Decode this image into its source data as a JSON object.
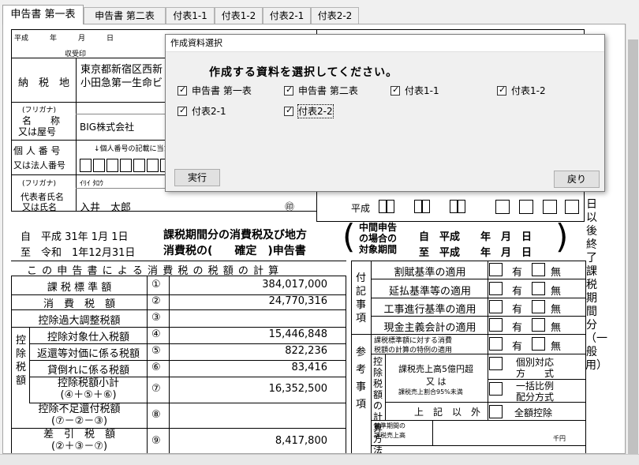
{
  "tabs": [
    {
      "label": "申告書 第一表",
      "active": true
    },
    {
      "label": "申告書 第二表"
    },
    {
      "label": "付表1-1"
    },
    {
      "label": "付表1-2"
    },
    {
      "label": "付表2-1"
    },
    {
      "label": "付表2-2"
    }
  ],
  "form": {
    "date_header": "平成　　　年　　　月　　　日",
    "received_stamp": "収受印",
    "address_label": "納　税　地",
    "address_line1": "東京都新宿区西新",
    "address_line2": "小田急第一生命ビ",
    "furigana": "(フリガナ)",
    "name_label_1": "名　　称",
    "name_label_2": "又は屋号",
    "company_name": "BIG株式会社",
    "number_label_1": "個 人 番 号",
    "number_label_2": "又は法人番号",
    "number_note": "↓個人番号の記載に当た",
    "rep_furigana": "ｲﾘｲ ﾀﾛｳ",
    "rep_label_1": "代表者氏名",
    "rep_label_2": "又は氏名",
    "rep_name": "入井　太郎",
    "seal": "㊞",
    "era_heisei": "平成",
    "period_from": "自　平成 31年 1月 1日",
    "period_to": "至　令和　1年12月31日",
    "title_line1": "課税期間分の消費税及び地方",
    "title_line2": "消費税の(　　確定　)申告書",
    "interim_label_1": "中間申告",
    "interim_label_2": "の場合の",
    "interim_label_3": "対象期間",
    "interim_from": "自　平成　　年　月　日",
    "interim_to": "至　平成　　年　月　日",
    "side_text": "日以後終了課税期間分（一般用）",
    "calc_header": "こ の 申 告 書 に よ る 消 費 税 の 税 額 の 計 算",
    "deduction_vertical": "控除税額",
    "rows": [
      {
        "label": "課 税 標 準 額",
        "num": "①",
        "value": "384,017,000"
      },
      {
        "label": "消　費　税　額",
        "num": "②",
        "value": "24,770,316"
      },
      {
        "label": "控除過大調整税額",
        "num": "③",
        "value": ""
      },
      {
        "label": "控除対象仕入税額",
        "num": "④",
        "value": "15,446,848"
      },
      {
        "label": "返還等対価に係る税額",
        "num": "⑤",
        "value": "822,236"
      },
      {
        "label": "貸倒れに係る税額",
        "num": "⑥",
        "value": "83,416"
      },
      {
        "label": "控除税額小計",
        "label2": "(④＋⑤＋⑥)",
        "num": "⑦",
        "value": "16,352,500"
      },
      {
        "label": "控除不足還付税額",
        "label2": "(⑦－②－③)",
        "num": "⑧",
        "value": ""
      },
      {
        "label": "差　引　税　額",
        "label2": "(②＋③－⑦)",
        "num": "⑨",
        "value": "8,417,800"
      }
    ],
    "notes_vertical": "付記事項",
    "ref_vertical": "参考事項",
    "notes": [
      {
        "label": "割賦基準の適用",
        "yes": "有",
        "no": "無"
      },
      {
        "label": "延払基準等の適用",
        "yes": "有",
        "no": "無"
      },
      {
        "label": "工事進行基準の適用",
        "yes": "有",
        "no": "無"
      },
      {
        "label": "現金主義会計の適用",
        "yes": "有",
        "no": "無"
      }
    ],
    "ref_special_1": "課税標準額に対する消費",
    "ref_special_2": "税額の計算の特例の適用",
    "ref_yes": "有",
    "ref_no": "無",
    "deduct_method_vertical": "控除税額の計算方法",
    "over500_1": "課税売上高5億円超",
    "over500_2": "又 は",
    "over500_3": "課税売上割合95%未満",
    "individual_1": "個別対応",
    "individual_2": "方　　式",
    "lump_1": "一括比例",
    "lump_2": "配分方式",
    "other_label": "上　記　以　外",
    "full_deduct": "全額控除",
    "base_sales_1": "基準期間の",
    "base_sales_2": "課税売上高",
    "thousand_yen": "千円",
    "heisei_short": "平成"
  },
  "dialog": {
    "title": "作成資料選択",
    "instruction": "作成する資料を選択してください。",
    "options": [
      {
        "label": "申告書 第一表",
        "checked": true
      },
      {
        "label": "申告書 第二表",
        "checked": true
      },
      {
        "label": "付表1-1",
        "checked": true
      },
      {
        "label": "付表1-2",
        "checked": true
      },
      {
        "label": "付表2-1",
        "checked": true
      },
      {
        "label": "付表2-2",
        "checked": true
      }
    ],
    "checkmark": "✓",
    "execute_label": "実行",
    "back_label": "戻り"
  }
}
